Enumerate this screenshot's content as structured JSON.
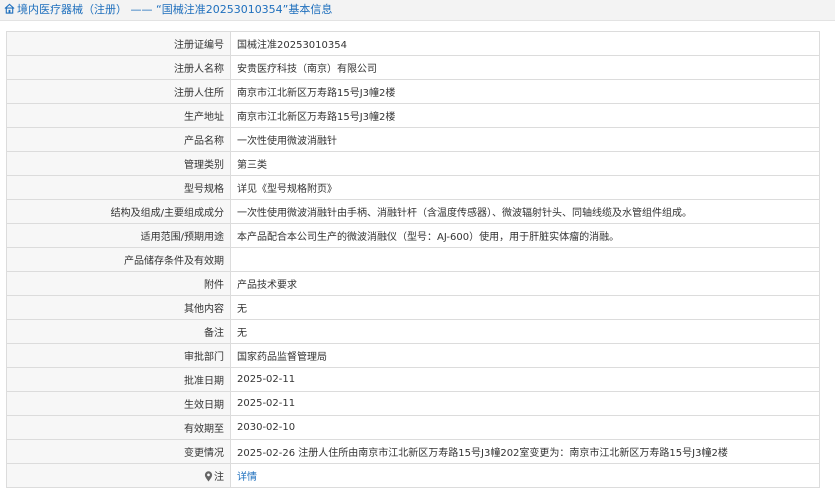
{
  "header": {
    "category": "境内医疗器械（注册）",
    "separator": "——",
    "record_title": "“国械注准20253010354”基本信息",
    "accent_color": "#1e6fbd"
  },
  "rows": [
    {
      "label": "注册证编号",
      "value": "国械注准20253010354"
    },
    {
      "label": "注册人名称",
      "value": "安贵医疗科技（南京）有限公司"
    },
    {
      "label": "注册人住所",
      "value": "南京市江北新区万寿路15号J3幢2楼"
    },
    {
      "label": "生产地址",
      "value": "南京市江北新区万寿路15号J3幢2楼"
    },
    {
      "label": "产品名称",
      "value": "一次性使用微波消融针"
    },
    {
      "label": "管理类别",
      "value": "第三类"
    },
    {
      "label": "型号规格",
      "value": "详见《型号规格附页》"
    },
    {
      "label": "结构及组成/主要组成成分",
      "value": "一次性使用微波消融针由手柄、消融针杆（含温度传感器）、微波辐射针头、同轴线缆及水管组件组成。"
    },
    {
      "label": "适用范围/预期用途",
      "value": "本产品配合本公司生产的微波消融仪（型号：AJ-600）使用，用于肝脏实体瘤的消融。"
    },
    {
      "label": "产品储存条件及有效期",
      "value": ""
    },
    {
      "label": "附件",
      "value": "产品技术要求"
    },
    {
      "label": "其他内容",
      "value": "无"
    },
    {
      "label": "备注",
      "value": "无"
    },
    {
      "label": "审批部门",
      "value": "国家药品监督管理局"
    },
    {
      "label": "批准日期",
      "value": "2025-02-11"
    },
    {
      "label": "生效日期",
      "value": "2025-02-11"
    },
    {
      "label": "有效期至",
      "value": "2030-02-10"
    },
    {
      "label": "变更情况",
      "value": "2025-02-26 注册人住所由南京市江北新区万寿路15号J3幢202室变更为：南京市江北新区万寿路15号J3幢2楼"
    }
  ],
  "note_row": {
    "label": "注",
    "link_text": "详情",
    "icon": "map-pin-icon"
  }
}
